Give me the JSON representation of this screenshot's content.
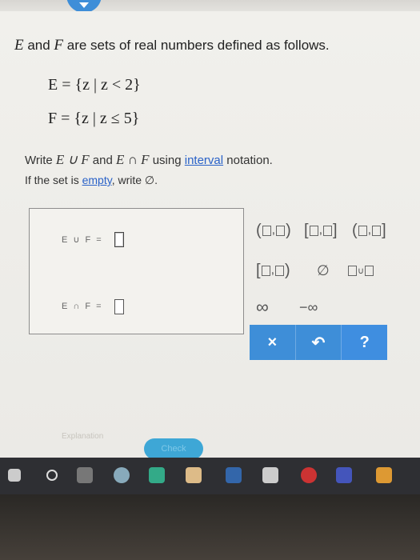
{
  "problem": {
    "title_e": "E",
    "title_and": " and ",
    "title_f": "F",
    "title_rest": " are sets of real numbers defined as follows.",
    "set_e": "E = {z | z < 2}",
    "set_f": "F = {z | z ≤ 5}",
    "instr_write": "Write ",
    "instr_union": "E ∪ F",
    "instr_and": " and ",
    "instr_inter": "E ∩ F",
    "instr_using": " using ",
    "instr_link": "interval",
    "instr_tail": " notation.",
    "empty_prefix": "If the set is ",
    "empty_link": "empty",
    "empty_suffix": ", write ∅."
  },
  "answers": {
    "union_label": "E ∪ F =",
    "union_value": "",
    "inter_label": "E ∩ F =",
    "inter_value": ""
  },
  "palette": {
    "open_open": "(□,□)",
    "closed_closed": "[□,□]",
    "open_closed": "(□,□]",
    "closed_open": "[□,□)",
    "empty_set": "∅",
    "union": "□∪□",
    "infinity": "∞",
    "neg_infinity": "−∞"
  },
  "toolbar": {
    "clear": "×",
    "undo": "↶",
    "help": "?"
  },
  "footer": {
    "explanation": "Explanation",
    "check": "Check"
  },
  "colors": {
    "accent": "#3e8ed8",
    "link": "#2a62c8",
    "check": "#3ea7d6"
  }
}
